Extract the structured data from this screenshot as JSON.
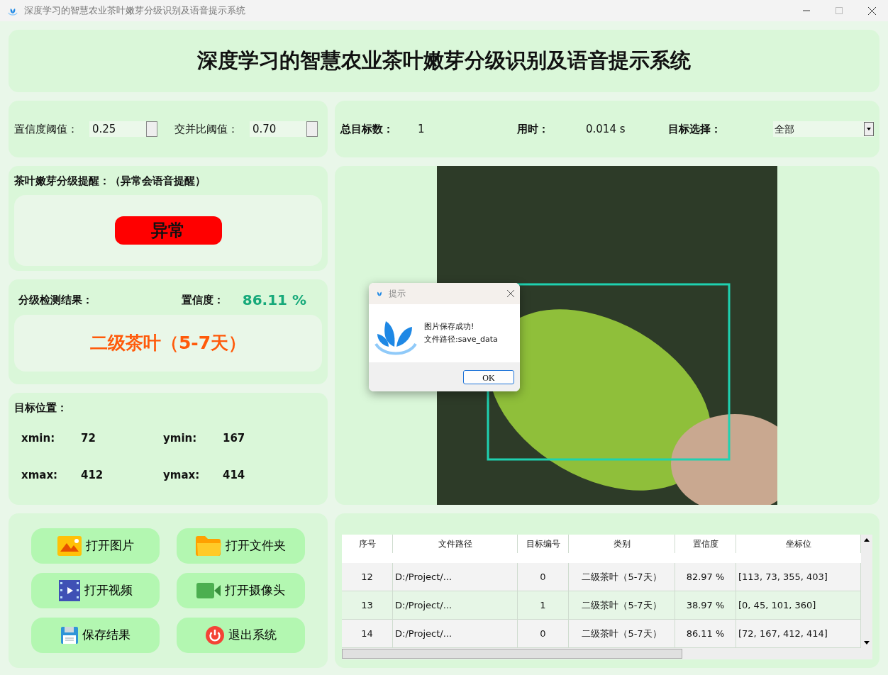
{
  "window": {
    "title": "深度学习的智慧农业茶叶嫩芽分级识别及语音提示系统"
  },
  "header": {
    "title": "深度学习的智慧农业茶叶嫩芽分级识别及语音提示系统"
  },
  "thresholds": [
    {
      "label": "置信度阈值：",
      "value": "0.25"
    },
    {
      "label": "交并比阈值：",
      "value": "0.70"
    }
  ],
  "stats": {
    "total_label": "总目标数：",
    "total": "1",
    "time_label": "用时：",
    "time": "0.014 s",
    "select_label": "目标选择：",
    "select_value": "全部"
  },
  "alert": {
    "title": "茶叶嫩芽分级提醒：（异常会语音提醒）",
    "status": "异常",
    "abnormal": true
  },
  "result": {
    "label": "分级检测结果：",
    "conf_label": "置信度：",
    "confidence": "86.11 %",
    "grade": "二级茶叶（5-7天）"
  },
  "position": {
    "title": "目标位置：",
    "coords": [
      {
        "label": "xmin:",
        "value": "72"
      },
      {
        "label": "ymin:",
        "value": "167"
      },
      {
        "label": "xmax:",
        "value": "412"
      },
      {
        "label": "ymax:",
        "value": "414"
      }
    ]
  },
  "buttons": [
    {
      "label": "打开图片",
      "kind": "image"
    },
    {
      "label": "打开文件夹",
      "kind": "folder"
    },
    {
      "label": "打开视频",
      "kind": "video"
    },
    {
      "label": "打开摄像头",
      "kind": "camera"
    },
    {
      "label": "保存结果",
      "kind": "save"
    },
    {
      "label": "退出系统",
      "kind": "power"
    }
  ],
  "table": {
    "columns": [
      "序号",
      "文件路径",
      "目标编号",
      "类别",
      "置信度",
      "坐标位"
    ],
    "rows": [
      [
        "12",
        "D:/Project/...",
        "0",
        "二级茶叶（5-7天）",
        "82.97 %",
        "[113, 73, 355, 403]"
      ],
      [
        "13",
        "D:/Project/...",
        "1",
        "二级茶叶（5-7天）",
        "38.97 %",
        "[0, 45, 101, 360]"
      ],
      [
        "14",
        "D:/Project/...",
        "0",
        "二级茶叶（5-7天）",
        "86.11 %",
        "[72, 167, 412, 414]"
      ]
    ]
  },
  "dialog": {
    "title": "提示",
    "lines": [
      "图片保存成功!",
      "文件路径:save_data"
    ],
    "button": "OK"
  }
}
